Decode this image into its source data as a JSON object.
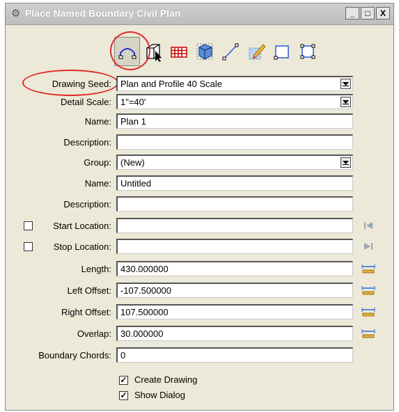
{
  "window": {
    "title": "Place Named Boundary Civil Plan",
    "minimize_glyph": "_",
    "maximize_glyph": "□",
    "close_glyph": "X"
  },
  "toolbar": {
    "tools": [
      {
        "name": "civil-plan-tool-icon",
        "active": true
      },
      {
        "name": "3d-box-tool-icon"
      },
      {
        "name": "grid-tool-icon"
      },
      {
        "name": "3d-view-tool-icon"
      },
      {
        "name": "line-tool-icon"
      },
      {
        "name": "pencil-shape-tool-icon"
      },
      {
        "name": "square-tool-icon"
      },
      {
        "name": "corner-square-tool-icon"
      }
    ]
  },
  "form": {
    "drawing_seed": {
      "label": "Drawing Seed:",
      "value": "Plan and Profile 40 Scale"
    },
    "detail_scale": {
      "label": "Detail Scale:",
      "value": "1\"=40'"
    },
    "name1": {
      "label": "Name:",
      "value": "Plan 1"
    },
    "description1": {
      "label": "Description:",
      "value": ""
    },
    "group": {
      "label": "Group:",
      "value": "(New)"
    },
    "name2": {
      "label": "Name:",
      "value": "Untitled"
    },
    "description2": {
      "label": "Description:",
      "value": ""
    },
    "start_location": {
      "label": "Start Location:",
      "value": "",
      "checked": false
    },
    "stop_location": {
      "label": "Stop Location:",
      "value": "",
      "checked": false
    },
    "length": {
      "label": "Length:",
      "value": "430.000000"
    },
    "left_offset": {
      "label": "Left Offset:",
      "value": "-107.500000"
    },
    "right_offset": {
      "label": "Right Offset:",
      "value": "107.500000"
    },
    "overlap": {
      "label": "Overlap:",
      "value": "30.000000"
    },
    "boundary_chords": {
      "label": "Boundary Chords:",
      "value": "0"
    },
    "create_drawing": {
      "label": "Create Drawing",
      "checked": true
    },
    "show_dialog": {
      "label": "Show Dialog",
      "checked": true
    }
  },
  "colors": {
    "annotation_circle": "#e02828",
    "dialog_background": "#ece9d8"
  }
}
